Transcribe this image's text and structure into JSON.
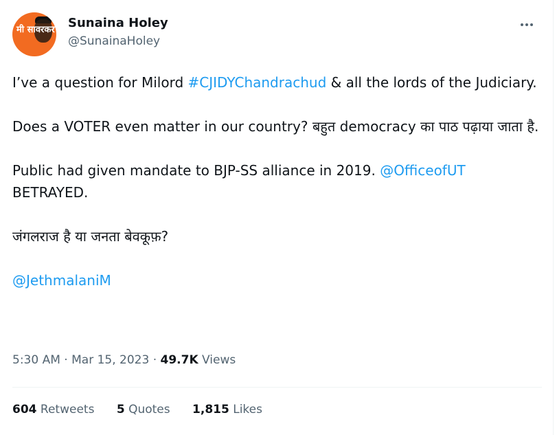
{
  "tweet": {
    "author": {
      "name": "Sunaina Holey",
      "handle": "@SunainaHoley",
      "avatar_text": "मी सावरकर"
    },
    "more_icon": "more-horizontal-icon",
    "paragraphs": {
      "p1": {
        "before": "I’ve a question for Milord ",
        "hashtag": "#CJIDYChandrachud",
        "after": " & all the lords of the Judiciary."
      },
      "p2": "Does a VOTER even matter in our country? बहुत democracy का पाठ पढ़ाया जाता है.",
      "p3": {
        "before": "Public had given mandate to BJP-SS alliance in 2019. ",
        "mention": "@OfficeofUT",
        "after": " BETRAYED."
      },
      "p4": "जंगलराज है या जनता बेवकूफ़?",
      "p5": {
        "mention": "@JethmalaniM"
      }
    },
    "meta": {
      "time": "5:30 AM",
      "sep1": " · ",
      "date": "Mar 15, 2023",
      "sep2": " · ",
      "views_count": "49.7K",
      "views_label": " Views"
    },
    "stats": {
      "retweets": {
        "count": "604",
        "label": " Retweets"
      },
      "quotes": {
        "count": "5",
        "label": " Quotes"
      },
      "likes": {
        "count": "1,815",
        "label": " Likes"
      }
    }
  },
  "colors": {
    "link": "#1d9bf0",
    "secondary": "#536471",
    "primary": "#0f1419",
    "avatar_bg": "#f26b21"
  }
}
